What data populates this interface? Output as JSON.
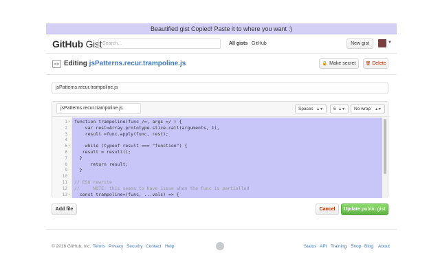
{
  "banner": "Beautified gist Copied! Paste it to where you want :)",
  "header": {
    "logo_bold": "GitHub",
    "logo_light": "Gist",
    "search_placeholder": "Search...",
    "nav": [
      "All gists",
      "GitHub"
    ],
    "new_gist": "New gist"
  },
  "title": {
    "icon": "code-icon",
    "prefix": "Editing",
    "filename": "jsPatterns.recur.trampoline.js",
    "make_secret": "Make secret",
    "delete": "Delete"
  },
  "description_value": "jsPatterns.recur.trampoline.js",
  "file": {
    "filename_value": "jsPatterns.recur.trampoline.js",
    "indent_mode": "Spaces",
    "indent_size": "6",
    "wrap_mode": "No wrap"
  },
  "code_lines": [
    {
      "n": "1",
      "fold": "▾",
      "text": "function trampoline(func /=, args =/ ) {"
    },
    {
      "n": "2",
      "fold": "",
      "text": "    var rest=Array.prototype.slice.call(arguments, 1),"
    },
    {
      "n": "3",
      "fold": "",
      "text": "    result =func.apply(func, rest);"
    },
    {
      "n": "4",
      "fold": "",
      "text": ""
    },
    {
      "n": "5",
      "fold": "▾",
      "text": "    while (typeof result === \"function\") {"
    },
    {
      "n": "6",
      "fold": "",
      "text": "   result = result();"
    },
    {
      "n": "7",
      "fold": "",
      "text": "  }"
    },
    {
      "n": "8",
      "fold": "",
      "text": "      return result;"
    },
    {
      "n": "9",
      "fold": "",
      "text": "  }"
    },
    {
      "n": "10",
      "fold": "",
      "text": ""
    },
    {
      "n": "11",
      "fold": "",
      "text": "// ES6 rewrite"
    },
    {
      "n": "12",
      "fold": "",
      "text": "//     NOTE: this seems to have issue when the func is partialled"
    },
    {
      "n": "13",
      "fold": "▾",
      "text": "  const trampoline=(func, ...vals) => {"
    }
  ],
  "actions": {
    "add_file": "Add file",
    "cancel": "Cancel",
    "update": "Update public gist"
  },
  "footer": {
    "copyright": "© 2016 GitHub, Inc.",
    "left_links": [
      "Terms",
      "Privacy",
      "Security",
      "Contact",
      "Help"
    ],
    "right_links": [
      "Status",
      "API",
      "Training",
      "Shop",
      "Blog",
      "About"
    ]
  },
  "colors": {
    "banner_bg": "#d4d0f5",
    "selection": "#c8c6f8",
    "link": "#4078c0",
    "primary_button": "#6cc644",
    "danger": "#bd2c00"
  }
}
